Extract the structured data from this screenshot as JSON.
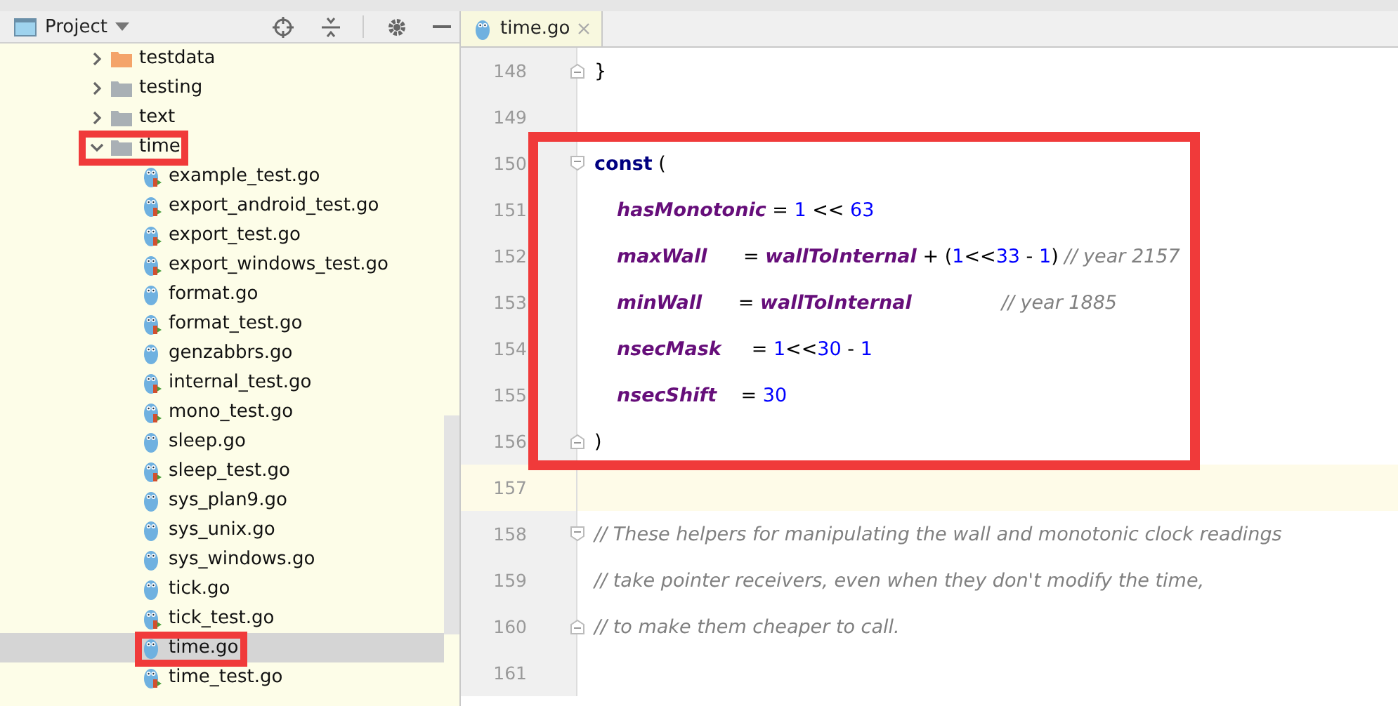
{
  "project_panel": {
    "title": "Project",
    "tree": [
      {
        "label": "testdata",
        "kind": "folder",
        "color": "#f4a46a",
        "expanded": false,
        "highlighted": false,
        "selected": false
      },
      {
        "label": "testing",
        "kind": "folder",
        "color": "#a9b0b5",
        "expanded": false,
        "highlighted": false,
        "selected": false
      },
      {
        "label": "text",
        "kind": "folder",
        "color": "#a9b0b5",
        "expanded": false,
        "highlighted": false,
        "selected": false
      },
      {
        "label": "time",
        "kind": "folder",
        "color": "#a9b0b5",
        "expanded": true,
        "highlighted": true,
        "selected": false,
        "children": [
          {
            "label": "example_test.go",
            "kind": "go_test",
            "highlighted": false,
            "selected": false
          },
          {
            "label": "export_android_test.go",
            "kind": "go_test",
            "highlighted": false,
            "selected": false
          },
          {
            "label": "export_test.go",
            "kind": "go_test",
            "highlighted": false,
            "selected": false
          },
          {
            "label": "export_windows_test.go",
            "kind": "go_test",
            "highlighted": false,
            "selected": false
          },
          {
            "label": "format.go",
            "kind": "go",
            "highlighted": false,
            "selected": false
          },
          {
            "label": "format_test.go",
            "kind": "go_test",
            "highlighted": false,
            "selected": false
          },
          {
            "label": "genzabbrs.go",
            "kind": "go",
            "highlighted": false,
            "selected": false
          },
          {
            "label": "internal_test.go",
            "kind": "go_test",
            "highlighted": false,
            "selected": false
          },
          {
            "label": "mono_test.go",
            "kind": "go_test",
            "highlighted": false,
            "selected": false
          },
          {
            "label": "sleep.go",
            "kind": "go",
            "highlighted": false,
            "selected": false
          },
          {
            "label": "sleep_test.go",
            "kind": "go_test",
            "highlighted": false,
            "selected": false
          },
          {
            "label": "sys_plan9.go",
            "kind": "go",
            "highlighted": false,
            "selected": false
          },
          {
            "label": "sys_unix.go",
            "kind": "go",
            "highlighted": false,
            "selected": false
          },
          {
            "label": "sys_windows.go",
            "kind": "go",
            "highlighted": false,
            "selected": false
          },
          {
            "label": "tick.go",
            "kind": "go",
            "highlighted": false,
            "selected": false
          },
          {
            "label": "tick_test.go",
            "kind": "go_test",
            "highlighted": false,
            "selected": false
          },
          {
            "label": "time.go",
            "kind": "go",
            "highlighted": true,
            "selected": true
          },
          {
            "label": "time_test.go",
            "kind": "go_test",
            "highlighted": false,
            "selected": false
          }
        ]
      }
    ]
  },
  "editor": {
    "tabs": [
      {
        "label": "time.go",
        "selected": true
      }
    ],
    "lines": [
      {
        "kind": "line",
        "number": "148",
        "fold_start": false,
        "fold_end": true,
        "current": false,
        "tokens": [
          {
            "kind": "plain",
            "text": "}"
          }
        ]
      },
      {
        "kind": "line",
        "number": "149",
        "fold_start": false,
        "fold_end": false,
        "current": false
      },
      {
        "kind": "highlight_group",
        "lines": [
          {
            "kind": "line",
            "number": "150",
            "fold_start": true,
            "fold_end": false,
            "current": false,
            "tokens": [
              {
                "kind": "keyword",
                "text": "const"
              },
              {
                "kind": "plain",
                "text": " ("
              }
            ]
          },
          {
            "kind": "spec",
            "number": "151",
            "fold_start": false,
            "fold_end": false,
            "current": false,
            "tokens": [
              {
                "kind": "constant",
                "text": "hasMonotonic"
              },
              {
                "kind": "plain",
                "text": " = "
              },
              {
                "kind": "number",
                "text": "1"
              },
              {
                "kind": "plain",
                "text": " << "
              },
              {
                "kind": "number",
                "text": "63"
              }
            ]
          },
          {
            "kind": "spec",
            "number": "152",
            "fold_start": false,
            "fold_end": false,
            "current": false,
            "tokens": [
              {
                "kind": "constant",
                "text": "maxWall"
              },
              {
                "kind": "plain",
                "text": "      = "
              },
              {
                "kind": "constant",
                "text": "wallToInternal"
              },
              {
                "kind": "plain",
                "text": " + ("
              },
              {
                "kind": "number",
                "text": "1"
              },
              {
                "kind": "plain",
                "text": "<<"
              },
              {
                "kind": "number",
                "text": "33"
              },
              {
                "kind": "plain",
                "text": " - "
              },
              {
                "kind": "number",
                "text": "1"
              },
              {
                "kind": "plain",
                "text": ") "
              },
              {
                "kind": "comment",
                "text": "// year 2157"
              }
            ]
          },
          {
            "kind": "spec",
            "number": "153",
            "fold_start": false,
            "fold_end": false,
            "current": false,
            "tokens": [
              {
                "kind": "constant",
                "text": "minWall"
              },
              {
                "kind": "plain",
                "text": "      = "
              },
              {
                "kind": "constant",
                "text": "wallToInternal"
              },
              {
                "kind": "aligned_comment",
                "text": "// year 1885"
              }
            ]
          },
          {
            "kind": "spec",
            "number": "154",
            "fold_start": false,
            "fold_end": false,
            "current": false,
            "tokens": [
              {
                "kind": "constant",
                "text": "nsecMask"
              },
              {
                "kind": "plain",
                "text": "     = "
              },
              {
                "kind": "number",
                "text": "1"
              },
              {
                "kind": "plain",
                "text": "<<"
              },
              {
                "kind": "number",
                "text": "30"
              },
              {
                "kind": "plain",
                "text": " - "
              },
              {
                "kind": "number",
                "text": "1"
              }
            ]
          },
          {
            "kind": "spec",
            "number": "155",
            "fold_start": false,
            "fold_end": false,
            "current": false,
            "tokens": [
              {
                "kind": "constant",
                "text": "nsecShift"
              },
              {
                "kind": "plain",
                "text": "    = "
              },
              {
                "kind": "number",
                "text": "30"
              }
            ]
          },
          {
            "kind": "line",
            "number": "156",
            "fold_start": false,
            "fold_end": true,
            "current": false,
            "tokens": [
              {
                "kind": "plain",
                "text": ")"
              }
            ]
          }
        ]
      },
      {
        "kind": "line",
        "number": "157",
        "fold_start": false,
        "fold_end": false,
        "current": true
      },
      {
        "kind": "line",
        "number": "158",
        "fold_start": true,
        "fold_end": false,
        "current": false,
        "tokens": [
          {
            "kind": "comment",
            "text": "// These helpers for manipulating the wall and monotonic clock readings"
          }
        ]
      },
      {
        "kind": "line",
        "number": "159",
        "fold_start": false,
        "fold_end": false,
        "current": false,
        "tokens": [
          {
            "kind": "comment",
            "text": "// take pointer receivers, even when they don't modify the time,"
          }
        ]
      },
      {
        "kind": "line",
        "number": "160",
        "fold_start": false,
        "fold_end": true,
        "current": false,
        "tokens": [
          {
            "kind": "comment",
            "text": "// to make them cheaper to call."
          }
        ]
      },
      {
        "kind": "line",
        "number": "161",
        "fold_start": false,
        "fold_end": false,
        "current": false
      }
    ]
  }
}
